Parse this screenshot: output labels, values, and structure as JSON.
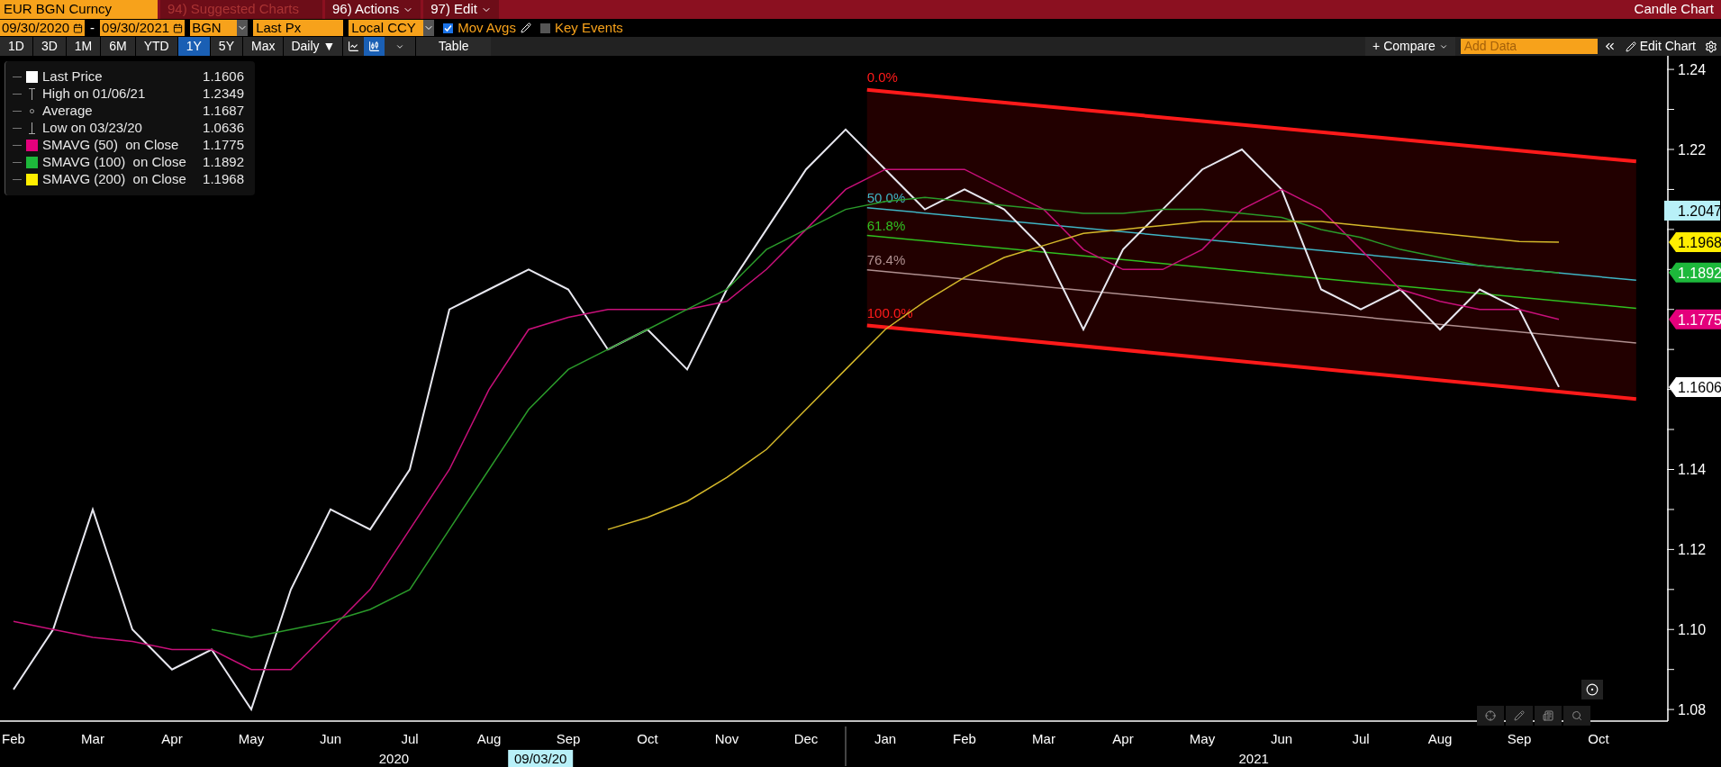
{
  "header": {
    "security": "EUR BGN Curncy",
    "menus": [
      {
        "text": "94) Suggested Charts",
        "disabled": true
      },
      {
        "text": "96) Actions",
        "disabled": false
      },
      {
        "text": "97) Edit",
        "disabled": false
      }
    ],
    "title": "Candle Chart"
  },
  "controls": {
    "start_date": "09/30/2020",
    "separator": "-",
    "end_date": "09/30/2021",
    "pricing_source": "BGN",
    "field": "Last Px",
    "currency": "Local CCY",
    "options": [
      {
        "label": "Mov Avgs",
        "checked": true
      },
      {
        "label": "Key Events",
        "checked": false
      }
    ]
  },
  "toolbar": {
    "periods": [
      {
        "label": "1D",
        "selected": false
      },
      {
        "label": "3D",
        "selected": false
      },
      {
        "label": "1M",
        "selected": false
      },
      {
        "label": "6M",
        "selected": false
      },
      {
        "label": "YTD",
        "selected": false
      },
      {
        "label": "1Y",
        "selected": true
      },
      {
        "label": "5Y",
        "selected": false
      },
      {
        "label": "Max",
        "selected": false
      }
    ],
    "frequency": "Daily ▼",
    "chart_types": [
      {
        "kind": "line",
        "selected": false
      },
      {
        "kind": "candle",
        "selected": true
      }
    ],
    "table": "Table",
    "compare": "+ Compare",
    "add_data_placeholder": "Add Data",
    "edit_chart": "Edit Chart"
  },
  "legend": [
    {
      "kind": "swatch",
      "color": "#ffffff",
      "label": "Last Price",
      "value": "1.1606"
    },
    {
      "kind": "high",
      "label": "High on 01/06/21",
      "value": "1.2349"
    },
    {
      "kind": "average",
      "label": "Average",
      "value": "1.1687"
    },
    {
      "kind": "low",
      "label": "Low on 03/23/20",
      "value": "1.0636"
    },
    {
      "kind": "swatch",
      "color": "#e4007c",
      "label": "SMAVG (50)  on Close",
      "value": "1.1775"
    },
    {
      "kind": "swatch",
      "color": "#1db83b",
      "label": "SMAVG (100)  on Close",
      "value": "1.1892"
    },
    {
      "kind": "swatch",
      "color": "#ffee00",
      "label": "SMAVG (200)  on Close",
      "value": "1.1968"
    }
  ],
  "fib_labels": [
    {
      "text": "0.0%",
      "color": "#ff1a1a"
    },
    {
      "text": "50.0%",
      "color": "#3fb5c5"
    },
    {
      "text": "61.8%",
      "color": "#30c020"
    },
    {
      "text": "76.4%",
      "color": "#b09090"
    },
    {
      "text": "100.0%",
      "color": "#ff1a1a"
    }
  ],
  "price_tags": [
    {
      "text": "1.2047",
      "color": "#b8f0f8",
      "kind": "box"
    },
    {
      "text": "1.1968",
      "color": "#ffee00",
      "kind": "flag"
    },
    {
      "text": "1.1892",
      "color": "#1db83b",
      "kind": "flag"
    },
    {
      "text": "1.1775",
      "color": "#e4007c",
      "kind": "flag"
    },
    {
      "text": "1.1606",
      "color": "#ffffff",
      "kind": "flag"
    }
  ],
  "x_axis": {
    "years": [
      "2020",
      "2021"
    ],
    "cursor_date": "09/03/20"
  },
  "chart_data": {
    "type": "line",
    "categories": [
      null,
      "Feb",
      null,
      "Mar",
      null,
      "Apr",
      null,
      "May",
      null,
      "Jun",
      null,
      "Jul",
      null,
      "Aug",
      null,
      "Sep",
      null,
      "Oct",
      null,
      "Nov",
      null,
      "Dec",
      null,
      "Jan",
      null,
      "Feb",
      null,
      "Mar",
      null,
      "Apr",
      null,
      "May",
      null,
      "Jun",
      null,
      "Jul",
      null,
      "Aug",
      null,
      "Sep",
      null,
      "Oct"
    ],
    "series": [
      {
        "color": "#e8e8f0",
        "values": [
          null,
          1.085,
          1.1,
          1.13,
          1.1,
          1.09,
          1.095,
          1.08,
          1.11,
          1.13,
          1.125,
          1.14,
          1.18,
          1.185,
          1.19,
          1.185,
          1.17,
          1.175,
          1.165,
          1.185,
          1.2,
          1.215,
          1.225,
          1.215,
          1.205,
          1.21,
          1.205,
          1.195,
          1.175,
          1.195,
          1.205,
          1.215,
          1.22,
          1.21,
          1.185,
          1.18,
          1.185,
          1.175,
          1.185,
          1.18,
          1.1606,
          null
        ]
      },
      {
        "color": "#c8107a",
        "values": [
          null,
          1.102,
          1.1,
          1.098,
          1.097,
          1.095,
          1.095,
          1.09,
          1.09,
          1.1,
          1.11,
          1.125,
          1.14,
          1.16,
          1.175,
          1.178,
          1.18,
          1.18,
          1.18,
          1.182,
          1.19,
          1.2,
          1.21,
          1.215,
          1.215,
          1.215,
          1.21,
          1.205,
          1.195,
          1.19,
          1.19,
          1.195,
          1.205,
          1.21,
          1.205,
          1.195,
          1.185,
          1.182,
          1.18,
          1.18,
          1.1775,
          null
        ]
      },
      {
        "color": "#2a9a2a",
        "values": [
          null,
          null,
          null,
          null,
          null,
          null,
          1.1,
          1.098,
          1.1,
          1.102,
          1.105,
          1.11,
          1.125,
          1.14,
          1.155,
          1.165,
          1.17,
          1.175,
          1.18,
          1.185,
          1.195,
          1.2,
          1.205,
          1.207,
          1.208,
          1.207,
          1.206,
          1.205,
          1.204,
          1.204,
          1.205,
          1.205,
          1.204,
          1.203,
          1.2,
          1.198,
          1.195,
          1.193,
          1.191,
          1.19,
          1.1892,
          null
        ]
      },
      {
        "color": "#d4b82a",
        "values": [
          null,
          null,
          null,
          null,
          null,
          null,
          null,
          null,
          null,
          null,
          null,
          null,
          null,
          null,
          null,
          null,
          1.125,
          1.128,
          1.132,
          1.138,
          1.145,
          1.155,
          1.165,
          1.175,
          1.182,
          1.188,
          1.193,
          1.196,
          1.199,
          1.2,
          1.201,
          1.202,
          1.202,
          1.202,
          1.202,
          1.201,
          1.2,
          1.199,
          1.198,
          1.197,
          1.1968,
          null
        ]
      }
    ],
    "ylim": [
      1.0771,
      1.2434
    ],
    "yticks": [
      {
        "value": 1.08,
        "label": "1.08"
      },
      {
        "value": 1.1,
        "label": "1.10"
      },
      {
        "value": 1.12,
        "label": "1.12"
      },
      {
        "value": 1.14,
        "label": "1.14"
      },
      {
        "value": 1.22,
        "label": "1.22"
      },
      {
        "value": 1.24,
        "label": "1.24"
      }
    ]
  }
}
